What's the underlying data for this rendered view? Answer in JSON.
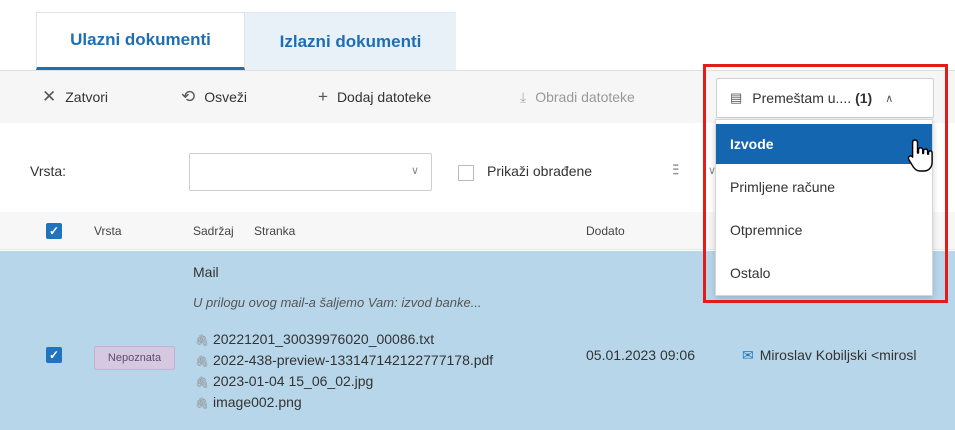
{
  "tabs": [
    {
      "label": "Ulazni dokumenti",
      "active": true
    },
    {
      "label": "Izlazni dokumenti",
      "active": false
    }
  ],
  "toolbar": {
    "close_label": "Zatvori",
    "refresh_label": "Osveži",
    "add_files_label": "Dodaj datoteke",
    "process_files_label": "Obradi datoteke",
    "move_label": "Premeštam u....",
    "move_count": "(1)"
  },
  "filters": {
    "type_label": "Vrsta:",
    "type_value": "",
    "show_processed_label": "Prikaži obrađene",
    "show_processed_checked": false
  },
  "table": {
    "columns": [
      "Vrsta",
      "Sadržaj",
      "Stranka",
      "Dodato"
    ],
    "select_all_checked": true,
    "rows": [
      {
        "checked": true,
        "type": "Nepoznata",
        "title": "Mail",
        "excerpt": "U prilogu ovog mail-a šaljemo Vam: izvod banke...",
        "attachments": [
          "20221201_30039976020_00086.txt",
          "2022-438-preview-133147142122777178.pdf",
          "2023-01-04 15_06_02.jpg",
          "image002.png"
        ],
        "added": "05.01.2023 09:06",
        "sender": "Miroslav Kobiljski <mirosl"
      }
    ]
  },
  "move_menu": {
    "items": [
      "Izvode",
      "Primljene račune",
      "Otpremnice",
      "Ostalo"
    ],
    "highlighted": "Izvode"
  },
  "colors": {
    "accent": "#1d6fb5",
    "menu_highlight": "#1566b0",
    "selected_row": "#b8d6ea",
    "highlight_frame": "#e21b1b",
    "badge_bg": "#d7c8e2"
  },
  "icons": {
    "close": "close-icon",
    "refresh": "refresh-icon",
    "add": "plus-icon",
    "process": "download-icon",
    "move": "document-move-icon",
    "columns": "sliders-icon",
    "attachment": "paperclip-icon",
    "mail": "envelope-icon"
  }
}
